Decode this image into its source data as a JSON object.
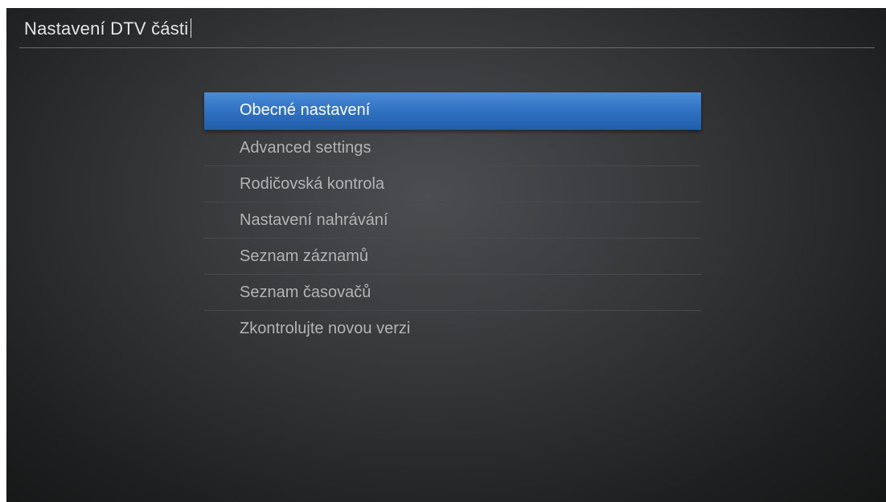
{
  "header": {
    "title": "Nastavení DTV části"
  },
  "menu": {
    "items": [
      {
        "label": "Obecné nastavení",
        "selected": true
      },
      {
        "label": "Advanced settings",
        "selected": false
      },
      {
        "label": "Rodičovská kontrola",
        "selected": false
      },
      {
        "label": "Nastavení nahrávání",
        "selected": false
      },
      {
        "label": "Seznam záznamů",
        "selected": false
      },
      {
        "label": "Seznam časovačů",
        "selected": false
      },
      {
        "label": "Zkontrolujte novou verzi",
        "selected": false
      }
    ]
  },
  "colors": {
    "selection": "#2e6fc0",
    "background": "#2c2d2f",
    "text": "#b3b3b3",
    "selected_text": "#ffffff"
  }
}
